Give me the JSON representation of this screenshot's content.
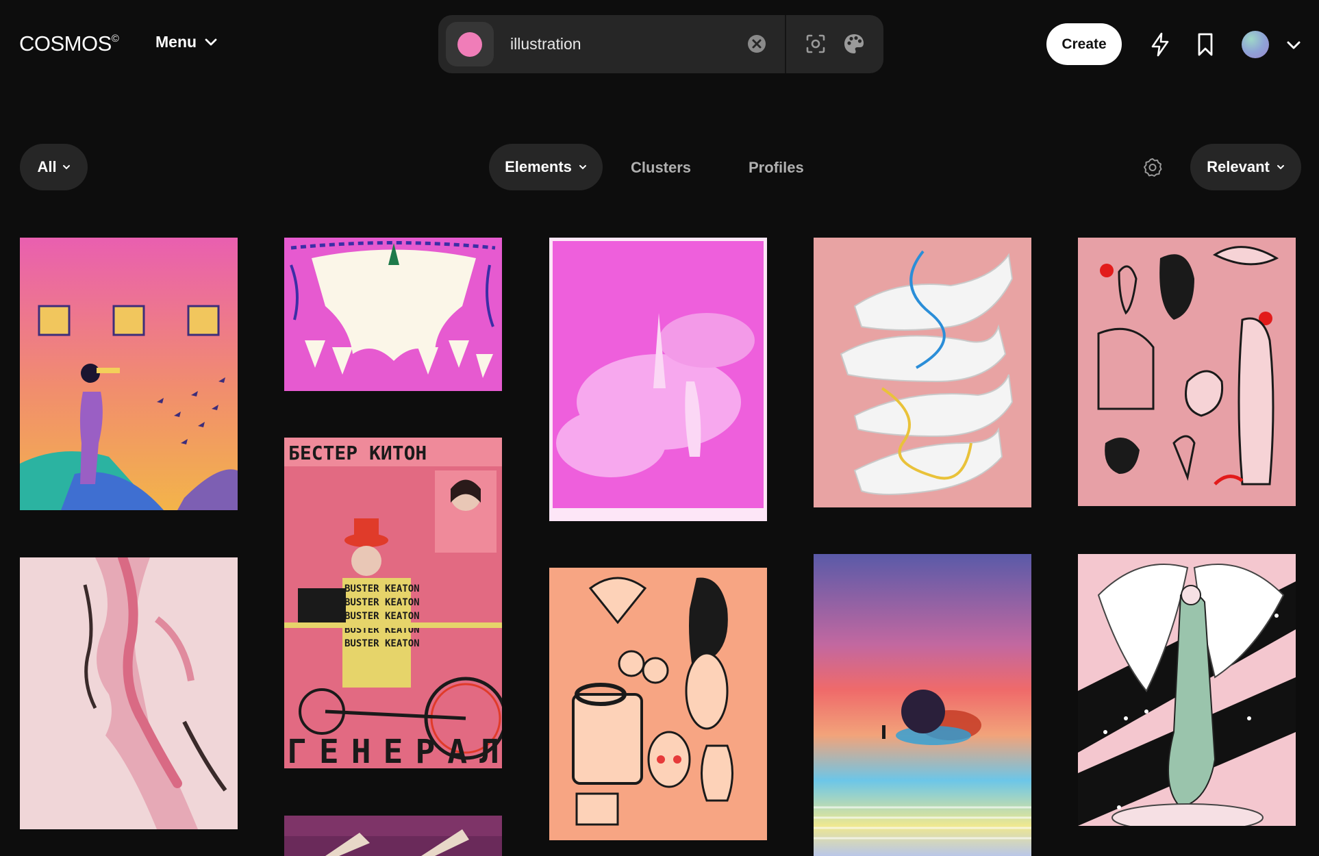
{
  "brand": {
    "logo_text": "COSMOS",
    "logo_mark": "©"
  },
  "nav": {
    "menu_label": "Menu"
  },
  "search": {
    "query": "illustration",
    "swatch_color": "#f07db8"
  },
  "header_actions": {
    "create_label": "Create"
  },
  "filters": {
    "scope_label": "All",
    "tabs": [
      {
        "label": "Elements",
        "active": true
      },
      {
        "label": "Clusters",
        "active": false
      },
      {
        "label": "Profiles",
        "active": false
      }
    ],
    "sort_label": "Relevant"
  },
  "artworks": [
    {
      "id": "a1",
      "subject": "woman with telescope at sunset",
      "palette": [
        "#e95fb0",
        "#f3a24a",
        "#2bb3a1"
      ]
    },
    {
      "id": "a2",
      "subject": "white cloaked figures on pink",
      "palette": [
        "#e65ad0",
        "#fbf6e8",
        "#3c2ea6"
      ]
    },
    {
      "id": "a3",
      "subject": "pink engraving angel in clouds",
      "palette": [
        "#ee5fdc",
        "#f7a8ee"
      ]
    },
    {
      "id": "a4",
      "subject": "intertwined hands with threads",
      "palette": [
        "#e8a3a3",
        "#ffffff",
        "#2b8ed8",
        "#e9c23a"
      ]
    },
    {
      "id": "a5",
      "subject": "tattoo flash sheet on pink",
      "palette": [
        "#e7a0a6",
        "#1a1a1a",
        "#e21b1b"
      ]
    },
    {
      "id": "a6",
      "subject": "pink distorted face",
      "palette": [
        "#f0d6d8",
        "#d96a84",
        "#3a2a2a"
      ]
    },
    {
      "id": "a7",
      "subject": "constructivist film poster",
      "palette": [
        "#e26a82",
        "#1a1a1a",
        "#e6d46a"
      ],
      "top_text": "БЕСТЕР КИТОН",
      "bottom_text": "ГЕНЕРАЛ"
    },
    {
      "id": "a8",
      "subject": "orange tattoo flash sheet",
      "palette": [
        "#f7a583",
        "#1a1a1a",
        "#e63a3a"
      ]
    },
    {
      "id": "a9",
      "subject": "figure and dark moon at sunset",
      "palette": [
        "#5a5aa8",
        "#ef6a6a",
        "#6cc6e8",
        "#efe890"
      ]
    },
    {
      "id": "a10",
      "subject": "angel with starry sash",
      "palette": [
        "#f4c7cf",
        "#111111",
        "#9ac4ac"
      ]
    },
    {
      "id": "a11",
      "subject": "partial purple artwork",
      "palette": [
        "#6a2a5a",
        "#e8d8c8"
      ]
    }
  ]
}
